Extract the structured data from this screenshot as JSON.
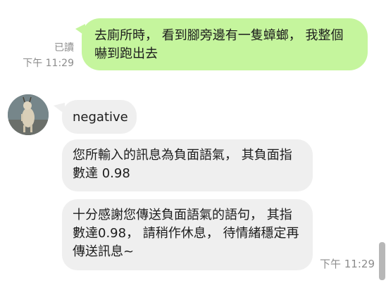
{
  "sent": {
    "text": "去廁所時， 看到腳旁邊有一隻蟑螂， 我整個嚇到跑出去",
    "read_label": "已讀",
    "time": "下午 11:29"
  },
  "received": {
    "messages": [
      {
        "text": "negative"
      },
      {
        "text": "您所輸入的訊息為負面語氣， 其負面指數達 0.98"
      },
      {
        "text": "十分感謝您傳送負面語氣的語句， 其指數達0.98， 請稍作休息， 待情緒穩定再傳送訊息~"
      }
    ],
    "time": "下午 11:29"
  },
  "colors": {
    "sent_bubble": "#c5f59d",
    "received_bubble": "#efefef",
    "meta_text": "#8c8c8c"
  }
}
